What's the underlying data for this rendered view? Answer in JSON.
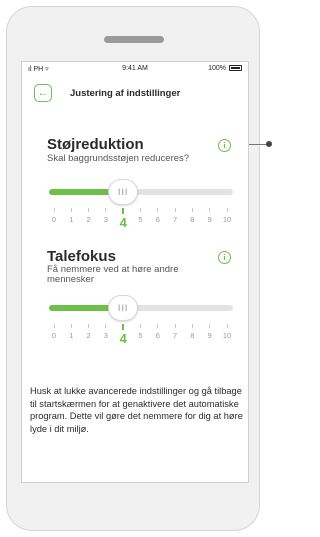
{
  "status_bar": {
    "carrier": "ıl PH",
    "wifi_glyph": "▿",
    "time": "9:41 AM",
    "battery_percent": "100%"
  },
  "header": {
    "title": "Justering af indstillinger",
    "back_glyph": "←"
  },
  "info_glyph": "i",
  "thumb_glyph": "III",
  "sections": [
    {
      "title": "Støjreduktion",
      "subtitle": "Skal baggrundsstøjen reduceres?",
      "selected_value": 4,
      "ticks": [
        "0",
        "1",
        "2",
        "3",
        "4",
        "5",
        "6",
        "7",
        "8",
        "9",
        "10"
      ]
    },
    {
      "title": "Talefokus",
      "subtitle": "Få nemmere ved at høre andre mennesker",
      "selected_value": 4,
      "ticks": [
        "0",
        "1",
        "2",
        "3",
        "4",
        "5",
        "6",
        "7",
        "8",
        "9",
        "10"
      ]
    }
  ],
  "footer_text": "Husk at lukke avancerede indstillinger og gå tilbage til startskærmen for at genaktivere det automatiske program. Dette vil gøre det nemmere for dig at høre lyde i dit miljø.",
  "colors": {
    "accent": "#6cc04a",
    "track": "#e3e3e3",
    "frame": "#f1f1f1"
  }
}
